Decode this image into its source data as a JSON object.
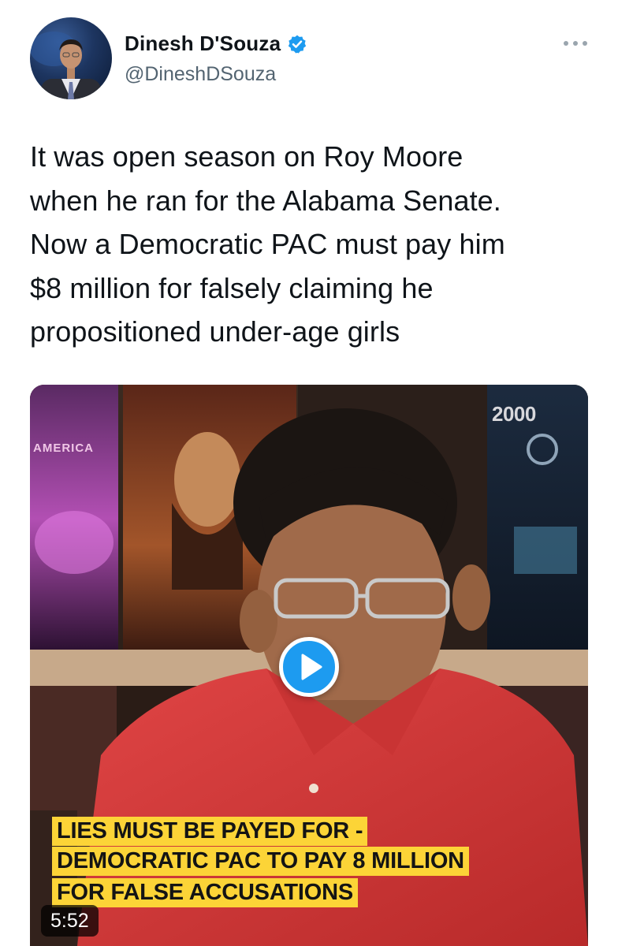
{
  "author": {
    "display_name": "Dinesh D'Souza",
    "handle": "@DineshDSouza",
    "verified": true,
    "avatar_icon": "profile-photo"
  },
  "more_icon": "more-dots-icon",
  "tweet": {
    "text": "It was open season on Roy Moore\nwhen he ran for the Alabama Senate.\nNow a Democratic PAC must pay him\n$8 million for falsely claiming he\npropositioned under-age girls"
  },
  "video": {
    "poster_year": "2000",
    "poster_left_title": "AMERICA",
    "caption_lines": [
      "LIES MUST BE PAYED FOR -",
      "DEMOCRATIC PAC TO PAY 8 MILLION",
      "FOR FALSE ACCUSATIONS"
    ],
    "duration": "5:52",
    "play_icon": "play-icon"
  },
  "colors": {
    "accent": "#1d9bf0",
    "caption_bg": "#fcd437",
    "handle": "#536471",
    "shirt": "#d83a3a"
  }
}
